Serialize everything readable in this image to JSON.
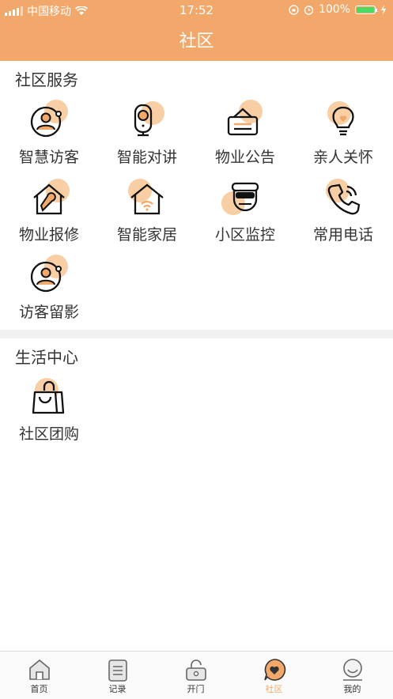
{
  "status_bar": {
    "carrier": "中国移动",
    "time": "17:52",
    "battery": "100%"
  },
  "header": {
    "title": "社区"
  },
  "sections": [
    {
      "title": "社区服务",
      "items": [
        {
          "label": "智慧访客",
          "icon": "visitor-icon"
        },
        {
          "label": "智能对讲",
          "icon": "intercom-icon"
        },
        {
          "label": "物业公告",
          "icon": "notice-icon"
        },
        {
          "label": "亲人关怀",
          "icon": "care-icon"
        },
        {
          "label": "物业报修",
          "icon": "repair-icon"
        },
        {
          "label": "智能家居",
          "icon": "smart-home-icon"
        },
        {
          "label": "小区监控",
          "icon": "camera-icon"
        },
        {
          "label": "常用电话",
          "icon": "phone-icon"
        },
        {
          "label": "访客留影",
          "icon": "visitor-photo-icon"
        }
      ]
    },
    {
      "title": "生活中心",
      "items": [
        {
          "label": "社区团购",
          "icon": "group-buy-icon"
        }
      ]
    }
  ],
  "tabbar": {
    "tabs": [
      {
        "label": "首页",
        "icon": "home-icon"
      },
      {
        "label": "记录",
        "icon": "record-icon"
      },
      {
        "label": "开门",
        "icon": "unlock-icon"
      },
      {
        "label": "社区",
        "icon": "community-icon",
        "active": true
      },
      {
        "label": "我的",
        "icon": "profile-icon"
      }
    ]
  },
  "colors": {
    "accent": "#f2a86a",
    "accent_light": "#f8cfa5",
    "text": "#333333"
  }
}
